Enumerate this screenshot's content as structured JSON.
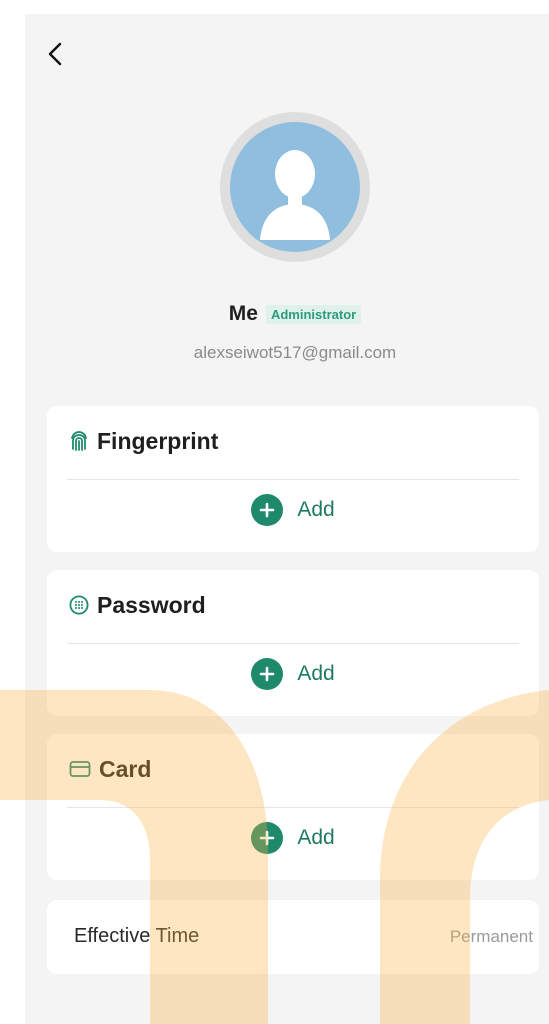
{
  "header": {
    "back_icon": "chevron-left-icon"
  },
  "profile": {
    "avatar_icon": "user-silhouette-icon",
    "name": "Me",
    "role_badge": "Administrator",
    "email": "alexseiwot517@gmail.com"
  },
  "sections": [
    {
      "title": "Fingerprint",
      "icon": "fingerprint-icon",
      "add_label": "Add",
      "add_icon": "plus-circle-icon"
    },
    {
      "title": "Password",
      "icon": "keypad-icon",
      "add_label": "Add",
      "add_icon": "plus-circle-icon"
    },
    {
      "title": "Card",
      "icon": "card-icon",
      "add_label": "Add",
      "add_icon": "plus-circle-icon"
    }
  ],
  "effective_time": {
    "label": "Effective Time",
    "value": "Permanent"
  },
  "colors": {
    "accent": "#1e8a6b",
    "badge_bg": "#def2ea",
    "badge_text": "#2e9a7f",
    "avatar_bg": "#8fbede",
    "screen_bg": "#f4f4f4",
    "watermark": "#fde3b4"
  }
}
